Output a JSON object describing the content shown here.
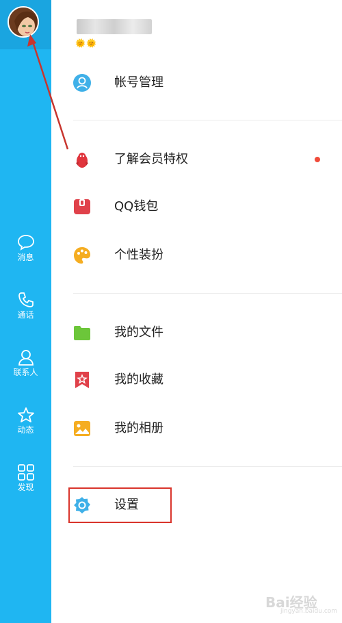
{
  "sidebar": {
    "items": [
      {
        "label": "消息",
        "icon": "message-icon"
      },
      {
        "label": "通话",
        "icon": "phone-icon"
      },
      {
        "label": "联系人",
        "icon": "contacts-icon"
      },
      {
        "label": "动态",
        "icon": "star-icon"
      },
      {
        "label": "发现",
        "icon": "grid-icon"
      }
    ]
  },
  "profile": {
    "suns": "🌞🌞"
  },
  "menu": {
    "account": "帐号管理",
    "vip": "了解会员特权",
    "wallet": "QQ钱包",
    "theme": "个性装扮",
    "files": "我的文件",
    "favorites": "我的收藏",
    "album": "我的相册",
    "settings": "设置"
  },
  "watermark": {
    "brand": "Bai经验",
    "url": "jingyan.baidu.com"
  },
  "colors": {
    "rail": "#1fb6f2",
    "highlight": "#d9342b",
    "dot": "#f04b3a"
  }
}
